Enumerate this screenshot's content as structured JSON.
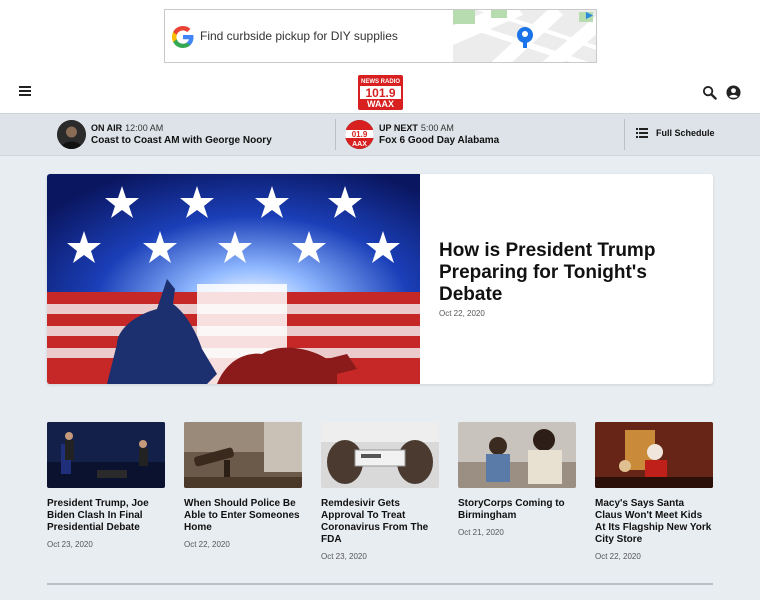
{
  "ad": {
    "text": "Find curbside pickup for DIY supplies"
  },
  "header": {
    "logo_line1": "NEWS RADIO",
    "logo_line2": "101.9",
    "logo_line3": "WAAX"
  },
  "on_air": {
    "label": "ON AIR",
    "time": "12:00 AM",
    "show": "Coast to Coast AM with George Noory"
  },
  "up_next": {
    "label": "UP NEXT",
    "time": "5:00 AM",
    "show": "Fox 6 Good Day Alabama",
    "logo_line1": "01.9",
    "logo_line2": "AAX"
  },
  "schedule": {
    "label": "Full Schedule"
  },
  "hero": {
    "title": "How is President Trump Preparing for Tonight's Debate",
    "date": "Oct 22, 2020"
  },
  "cards": [
    {
      "title": "President Trump, Joe Biden Clash In Final Presidential Debate",
      "date": "Oct 23, 2020"
    },
    {
      "title": "When Should Police Be Able to Enter Someones Home",
      "date": "Oct 22, 2020"
    },
    {
      "title": "Remdesivir Gets Approval To Treat Coronavirus From The FDA",
      "date": "Oct 23, 2020"
    },
    {
      "title": "StoryCorps Coming to Birmingham",
      "date": "Oct 21, 2020"
    },
    {
      "title": "Macy's Says Santa Claus Won't Meet Kids At Its Flagship New York City Store",
      "date": "Oct 22, 2020"
    }
  ],
  "colors": {
    "brand_red": "#d7201f",
    "page_bg": "#e8edf1",
    "bar_bg": "#dde3e8"
  }
}
